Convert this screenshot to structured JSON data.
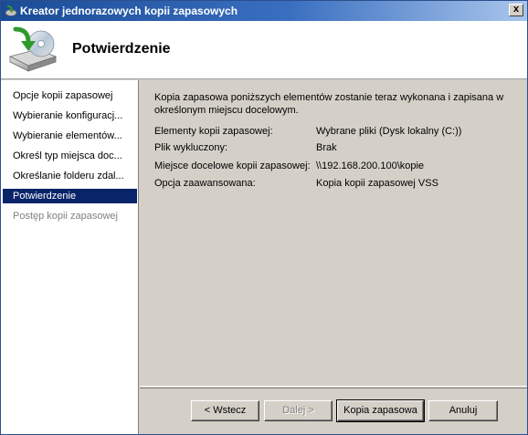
{
  "window": {
    "title": "Kreator jednorazowych kopii zapasowych",
    "close_label": "x"
  },
  "header": {
    "title": "Potwierdzenie",
    "icon": "backup-disk-icon"
  },
  "sidebar": {
    "items": [
      {
        "label": "Opcje kopii zapasowej",
        "state": "normal"
      },
      {
        "label": "Wybieranie konfiguracj...",
        "state": "normal"
      },
      {
        "label": "Wybieranie elementów...",
        "state": "normal"
      },
      {
        "label": "Określ typ miejsca doc...",
        "state": "normal"
      },
      {
        "label": "Określanie folderu zdal...",
        "state": "normal"
      },
      {
        "label": "Potwierdzenie",
        "state": "active"
      },
      {
        "label": "Postęp kopii zapasowej",
        "state": "disabled"
      }
    ]
  },
  "main": {
    "intro": "Kopia zapasowa poniższych elementów zostanie teraz wykonana i zapisana w określonym miejscu docelowym.",
    "rows": [
      {
        "label": "Elementy kopii zapasowej:",
        "value": "Wybrane pliki (Dysk lokalny (C:))"
      },
      {
        "label": "Plik wykluczony:",
        "value": "Brak"
      },
      {
        "label": "Miejsce docelowe kopii zapasowej:",
        "value": "\\\\192.168.200.100\\kopie"
      },
      {
        "label": "Opcja zaawansowana:",
        "value": "Kopia kopii zapasowej VSS"
      }
    ]
  },
  "buttons": {
    "back": "< Wstecz",
    "next": "Dalej >",
    "backup": "Kopia zapasowa",
    "cancel": "Anuluj"
  }
}
